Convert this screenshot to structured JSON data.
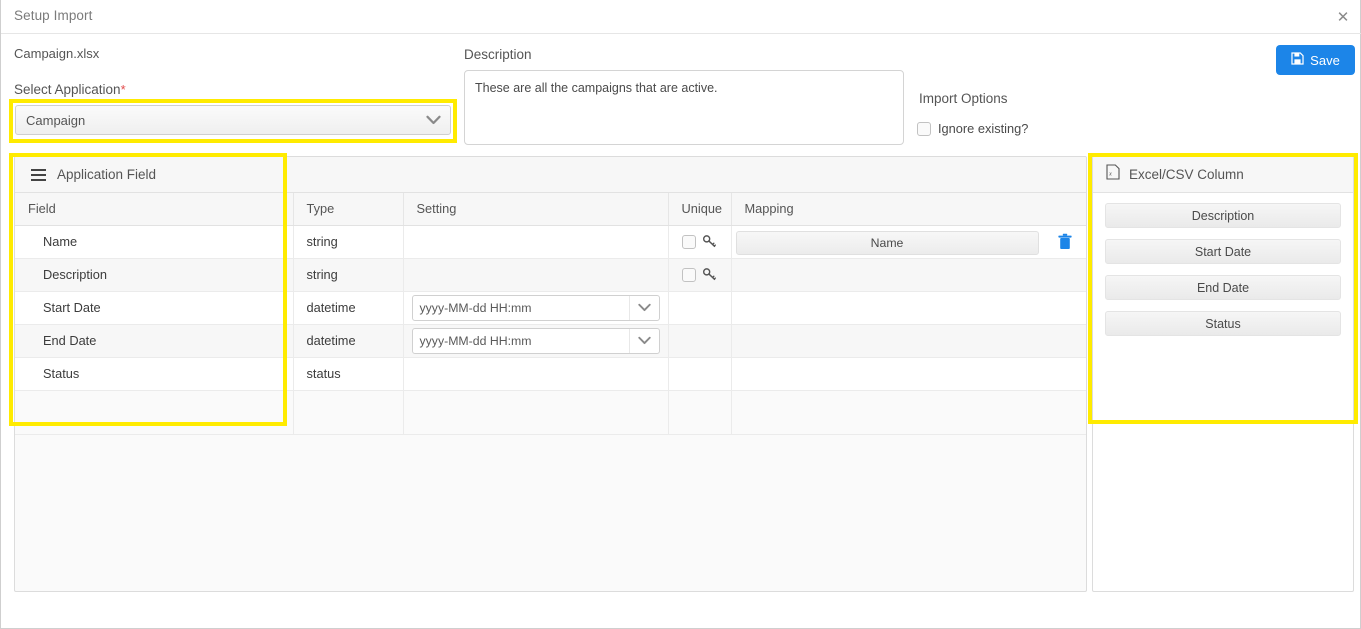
{
  "window": {
    "title": "Setup Import",
    "close_icon": "close-icon"
  },
  "form": {
    "filename": "Campaign.xlsx",
    "select_application_label": "Select Application",
    "required_marker": "*",
    "selected_application": "Campaign",
    "description_label": "Description",
    "description_value": "These are all the campaigns that are active.",
    "import_options_label": "Import Options",
    "ignore_existing_label": "Ignore existing?",
    "ignore_existing_checked": false,
    "save_label": "Save",
    "save_icon": "save-floppy-icon",
    "accent_color": "#1c85e8"
  },
  "grid": {
    "panel_title": "Application Field",
    "panel_icon": "hamburger-icon",
    "columns": [
      "Field",
      "Type",
      "Setting",
      "Unique",
      "Mapping"
    ],
    "rows": [
      {
        "field": "Name",
        "type": "string",
        "setting": "",
        "has_setting_select": false,
        "has_unique": true,
        "unique_checked": false,
        "mapping": "Name",
        "has_mapping": true
      },
      {
        "field": "Description",
        "type": "string",
        "setting": "",
        "has_setting_select": false,
        "has_unique": true,
        "unique_checked": false,
        "mapping": "",
        "has_mapping": false
      },
      {
        "field": "Start Date",
        "type": "datetime",
        "setting": "yyyy-MM-dd HH:mm",
        "has_setting_select": true,
        "has_unique": false,
        "unique_checked": false,
        "mapping": "",
        "has_mapping": false
      },
      {
        "field": "End Date",
        "type": "datetime",
        "setting": "yyyy-MM-dd HH:mm",
        "has_setting_select": true,
        "has_unique": false,
        "unique_checked": false,
        "mapping": "",
        "has_mapping": false
      },
      {
        "field": "Status",
        "type": "status",
        "setting": "",
        "has_setting_select": false,
        "has_unique": false,
        "unique_checked": false,
        "mapping": "",
        "has_mapping": false
      }
    ]
  },
  "csv_panel": {
    "title": "Excel/CSV Column",
    "icon": "excel-file-icon",
    "items": [
      "Description",
      "Start Date",
      "End Date",
      "Status"
    ]
  },
  "annotations": {
    "color": "#ffeb00",
    "boxes": [
      "select-application-dropdown",
      "application-field-column",
      "excel-csv-column-panel"
    ]
  }
}
